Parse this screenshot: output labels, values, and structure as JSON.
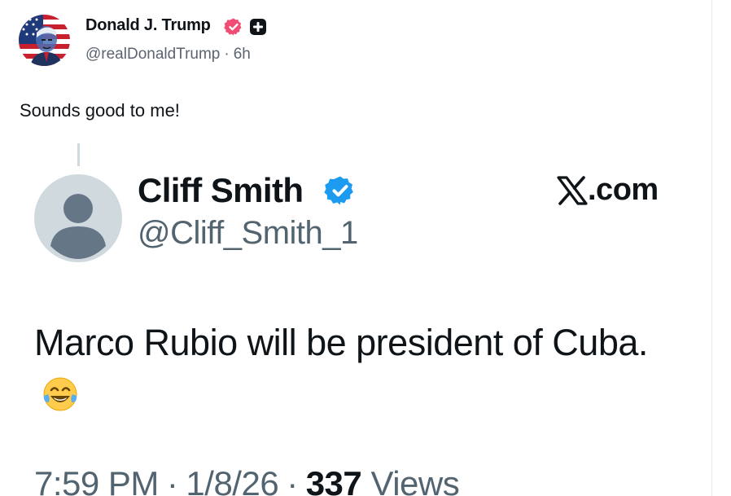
{
  "colors": {
    "text_primary": "#0f1419",
    "text_secondary": "#536471",
    "verified_pink": "#f14c73",
    "verified_blue": "#1d9bf0",
    "divider": "#e9eaed"
  },
  "post": {
    "author": {
      "display_name": "Donald J. Trump",
      "handle": "@realDonaldTrump",
      "separator": "·",
      "time_ago": "6h",
      "avatar_icon": "american-flag-portrait-avatar",
      "verified_icon": "verified-badge-icon",
      "extra_icon": "plus-square-icon"
    },
    "text": "Sounds good to me!"
  },
  "embed": {
    "author": {
      "display_name": "Cliff Smith",
      "handle": "@Cliff_Smith_1",
      "avatar_icon": "default-user-avatar",
      "verified_icon": "verified-badge-icon"
    },
    "source": {
      "logo_icon": "x-logo-icon",
      "domain": ".com"
    },
    "text": "Marco Rubio will be president of Cuba.",
    "emoji": "face-with-tears-of-joy",
    "meta": {
      "time": "7:59 PM",
      "date": "1/8/26",
      "separator": "·",
      "views_count": "337",
      "views_label": "Views"
    }
  }
}
